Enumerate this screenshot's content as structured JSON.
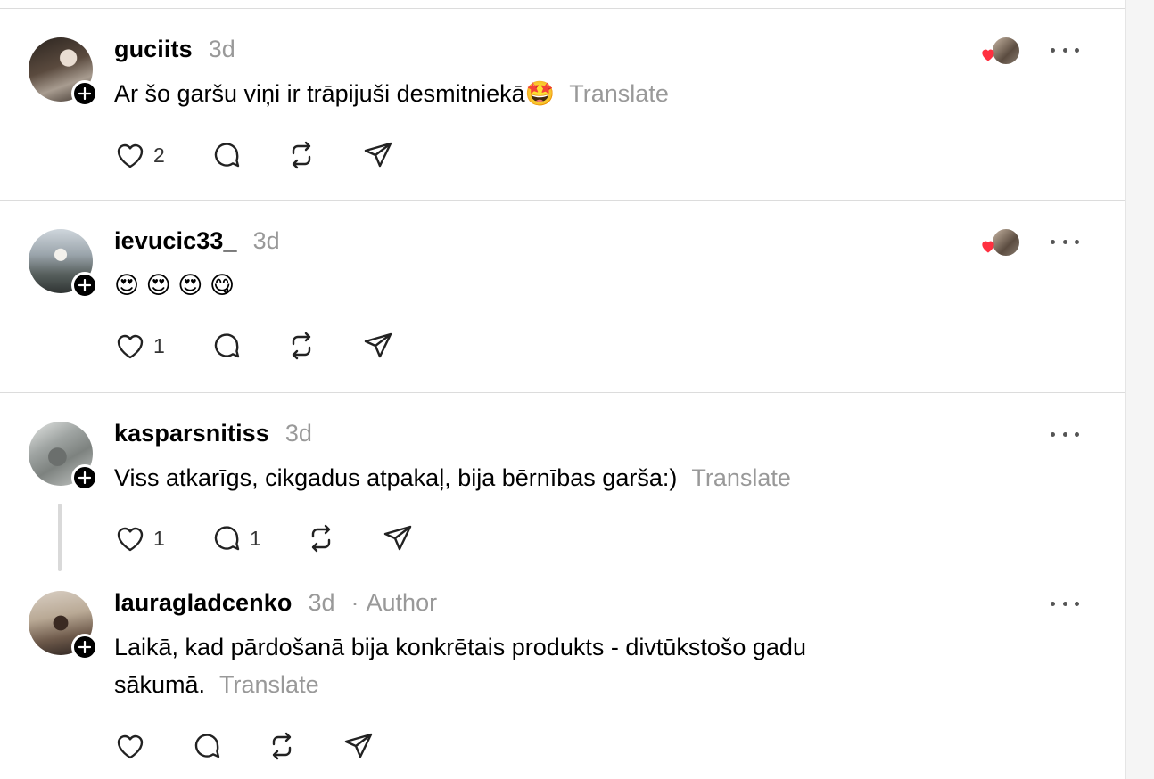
{
  "colors": {
    "muted": "#999999",
    "heart_red": "#ff3040",
    "divider": "#dcdcdc"
  },
  "posts": [
    {
      "username": "guciits",
      "time": "3d",
      "text": "Ar šo garšu viņi ir trāpijuši desmitniekā🤩",
      "translate": "Translate",
      "likes": "2",
      "replies": "",
      "liked_by_creator": true
    },
    {
      "username": "ievucic33_",
      "time": "3d",
      "text": "😍 😍 😍 😋",
      "translate": "",
      "likes": "1",
      "replies": "",
      "liked_by_creator": true
    },
    {
      "username": "kasparsnitiss",
      "time": "3d",
      "text": "Viss atkarīgs, cikgadus atpakaļ, bija bērnības garša:)",
      "translate": "Translate",
      "likes": "1",
      "replies": "1",
      "liked_by_creator": false
    },
    {
      "username": "lauragladcenko",
      "time": "3d",
      "separator": "·",
      "author_label": "Author",
      "text_line1": "Laikā, kad pārdošanā bija konkrētais produkts - divtūkstošo gadu",
      "text_line2": "sākumā.",
      "translate": "Translate",
      "likes": "",
      "replies": "",
      "liked_by_creator": false
    }
  ],
  "icons": {
    "like": "heart-outline-icon",
    "reply": "speech-bubble-icon",
    "repost": "repost-arrows-icon",
    "share": "paper-plane-icon",
    "more": "ellipsis-icon",
    "follow": "plus-icon"
  }
}
